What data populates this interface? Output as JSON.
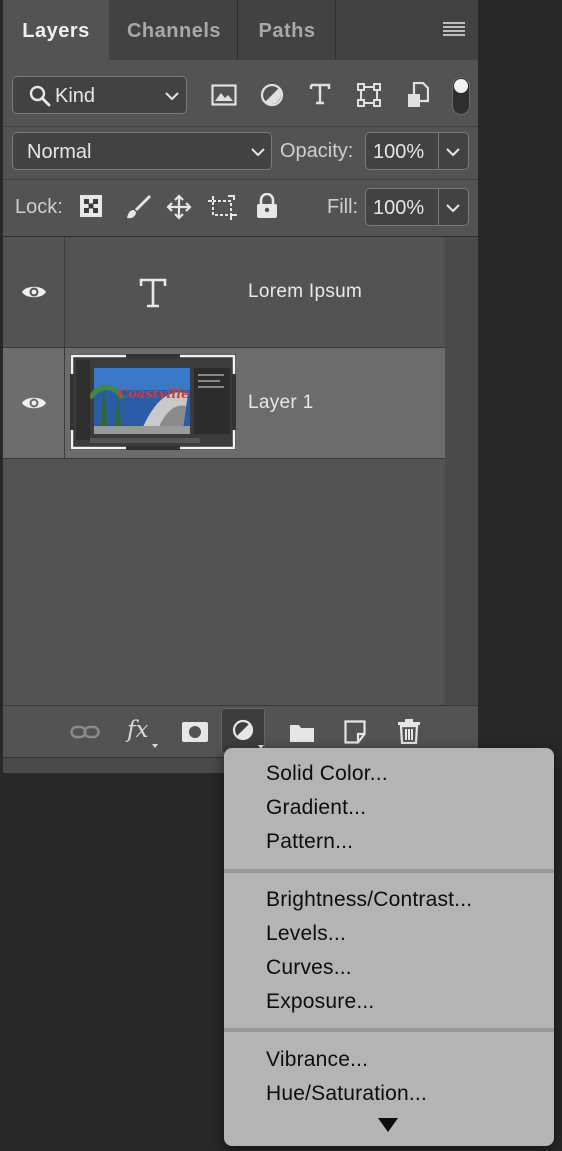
{
  "panel": {
    "tabs": [
      {
        "label": "Layers",
        "active": true
      },
      {
        "label": "Channels",
        "active": false
      },
      {
        "label": "Paths",
        "active": false
      }
    ]
  },
  "filter": {
    "kind_label": "Kind",
    "icons": [
      "image-filter-icon",
      "adjustment-filter-icon",
      "type-filter-icon",
      "shape-filter-icon",
      "smart-object-filter-icon"
    ]
  },
  "blend": {
    "mode": "Normal",
    "opacity_label": "Opacity:",
    "opacity_value": "100%"
  },
  "lock": {
    "label": "Lock:",
    "fill_label": "Fill:",
    "fill_value": "100%"
  },
  "layers": [
    {
      "name": "Lorem Ipsum",
      "type": "text",
      "selected": false
    },
    {
      "name": "Layer 1",
      "type": "image",
      "selected": true
    }
  ],
  "bottombar": {
    "fx_label": "fx"
  },
  "popup": {
    "groups": [
      [
        "Solid Color...",
        "Gradient...",
        "Pattern..."
      ],
      [
        "Brightness/Contrast...",
        "Levels...",
        "Curves...",
        "Exposure..."
      ],
      [
        "Vibrance...",
        "Hue/Saturation..."
      ]
    ]
  },
  "colors": {
    "panel_bg": "#535353",
    "selected_layer": "#6c6c6c",
    "menu_bg": "#b4b4b4"
  }
}
